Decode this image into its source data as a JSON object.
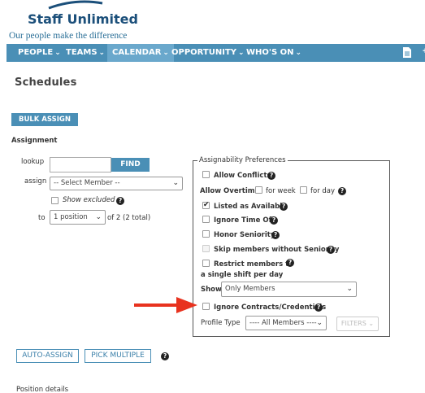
{
  "brand": {
    "name": "Staff Unlimited",
    "tagline": "Our people make the difference"
  },
  "nav": {
    "items": [
      {
        "label": "PEOPLE"
      },
      {
        "label": "TEAMS"
      },
      {
        "label": "CALENDAR"
      },
      {
        "label": "OPPORTUNITY"
      },
      {
        "label": "WHO'S ON"
      }
    ],
    "active": "CALENDAR"
  },
  "page": {
    "title": "Schedules",
    "bulk_assign": "BULK ASSIGN",
    "section_assignment": "Assignment",
    "lookup_label": "lookup",
    "lookup_value": "",
    "find_button": "FIND",
    "assign_label": "assign",
    "assign_select": "-- Select Member --",
    "show_excluded": "Show excluded",
    "to_label": "to",
    "position_select": "1 position",
    "position_of": "of 2 (2 total)",
    "auto_assign": "AUTO-ASSIGN",
    "pick_multiple": "PICK MULTIPLE",
    "position_details": "Position details"
  },
  "prefs": {
    "legend": "Assignability Preferences",
    "allow_conflicts": "Allow Conflicts",
    "allow_overtime": "Allow Overtime",
    "for_week": "for week",
    "for_day": "for day",
    "listed_as_available": "Listed as Available",
    "ignore_time_off": "Ignore Time Off",
    "honor_seniority": "Honor Seniority",
    "skip_members": "Skip members without Seniority",
    "restrict_line1": "Restrict members to",
    "restrict_line2": "a single shift per day",
    "show_label": "Show",
    "show_select": "Only Members",
    "ignore_contracts": "Ignore Contracts/Credentials",
    "profile_type_label": "Profile Type",
    "profile_select": "---- All Members ----",
    "filters": "FILTERS",
    "checked": {
      "allow_conflicts": false,
      "for_week": false,
      "for_day": false,
      "listed_as_available": true,
      "ignore_time_off": false,
      "honor_seniority": false,
      "skip_members": false,
      "restrict": false,
      "ignore_contracts": false,
      "show_excluded": false
    }
  },
  "colors": {
    "nav_bg": "#4a8fb6",
    "brand": "#1b4f7a",
    "arrow": "#e8321e"
  }
}
